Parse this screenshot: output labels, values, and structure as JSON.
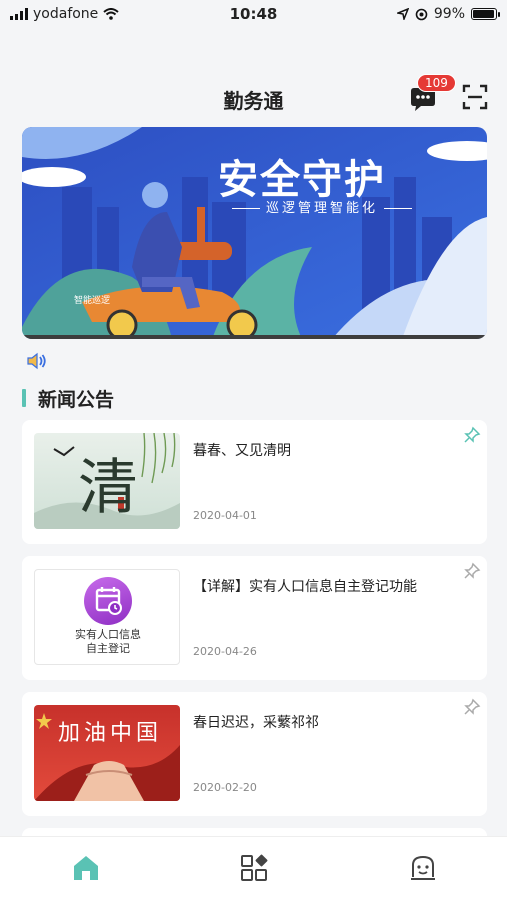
{
  "status_bar": {
    "carrier": "yodafone",
    "time": "10:48",
    "battery": "99%"
  },
  "header": {
    "title": "勤务通",
    "message_badge": "109"
  },
  "banner": {
    "title": "安全守护",
    "subtitle": "巡逻管理智能化",
    "tag": "智能巡逻"
  },
  "section": {
    "title": "新闻公告"
  },
  "news": [
    {
      "title": "暮春、又见清明",
      "date": "2020-04-01",
      "thumb_text": "清"
    },
    {
      "title": "【详解】实有人口信息自主登记功能",
      "date": "2020-04-26",
      "thumb_line1": "实有人口信息",
      "thumb_line2": "自主登记"
    },
    {
      "title": "春日迟迟，采蘩祁祁",
      "date": "2020-02-20",
      "thumb_text": "加油中国"
    }
  ],
  "icons": {
    "message": "chat-bubble-icon",
    "scan": "scan-icon",
    "speaker": "speaker-icon",
    "pin": "pin-icon",
    "tab_home": "home-icon",
    "tab_apps": "apps-grid-icon",
    "tab_profile": "profile-face-icon"
  },
  "colors": {
    "accent": "#5ac2b4",
    "badge": "#e53935",
    "banner_blue": "#2f57c7"
  }
}
